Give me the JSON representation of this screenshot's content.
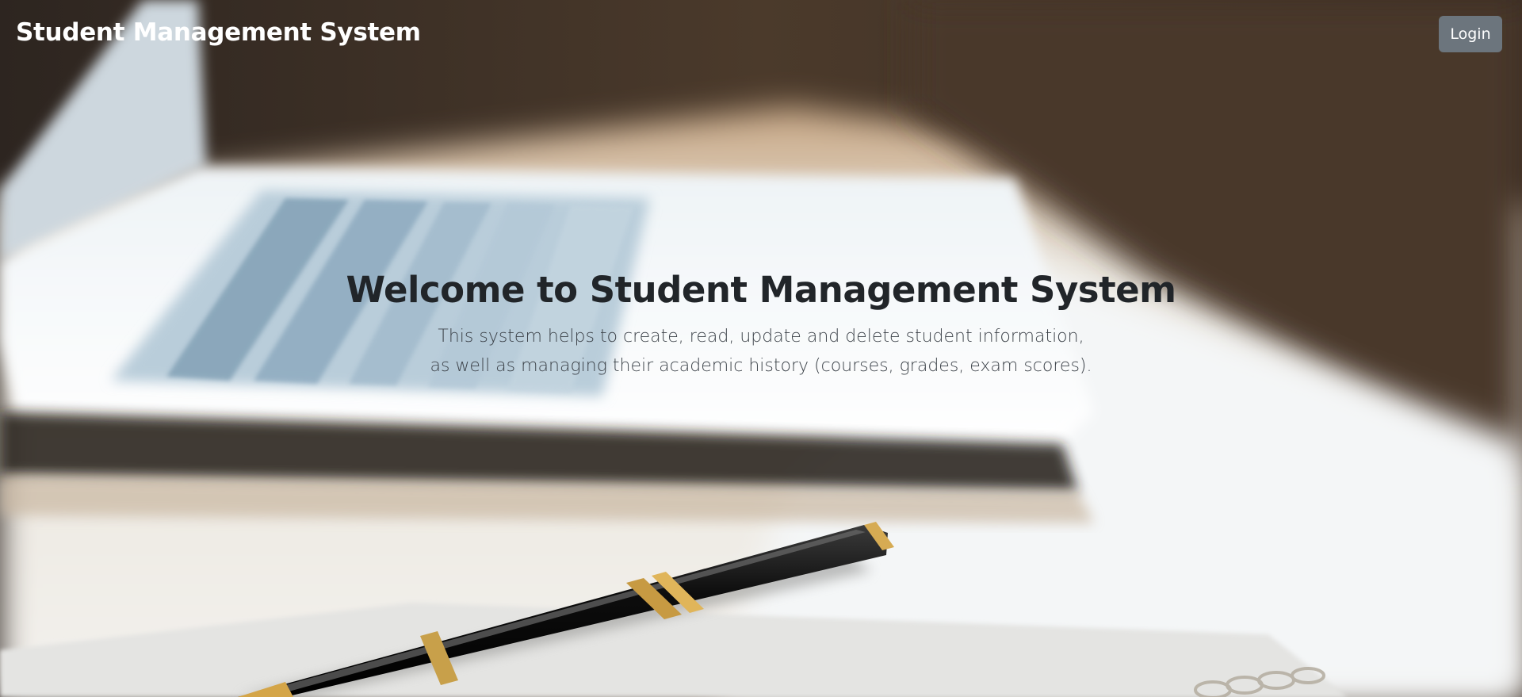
{
  "navbar": {
    "brand": "Student Management System",
    "login_label": "Login"
  },
  "hero": {
    "title": "Welcome to Student Management System",
    "description_line1": "This system helps to create, read, update and delete student information,",
    "description_line2": "as well as managing their academic history (courses, grades, exam scores)."
  },
  "background": {
    "image": "laptop-and-pen-on-desk-photo"
  }
}
